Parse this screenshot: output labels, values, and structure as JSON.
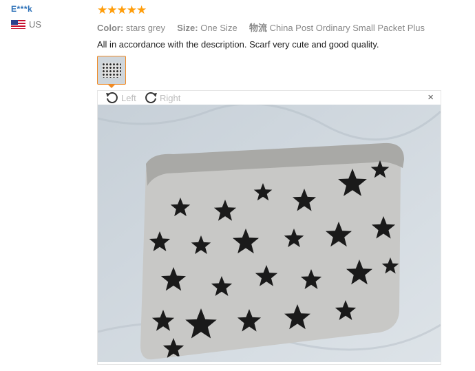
{
  "reviewer": {
    "name": "E***k",
    "country": "US"
  },
  "rating": {
    "stars": "★★★★★",
    "value": 5
  },
  "meta": {
    "color_label": "Color:",
    "color_value": "stars grey",
    "size_label": "Size:",
    "size_value": "One Size",
    "logistics_label": "物流",
    "logistics_value": "China Post Ordinary Small Packet Plus"
  },
  "review_text": "All in accordance with the description. Scarf very cute and good quality.",
  "viewer": {
    "rotate_left": "Left",
    "rotate_right": "Right",
    "close": "×"
  },
  "colors": {
    "accent": "#ff9d0a",
    "link": "#2a6fb7",
    "thumb_border": "#f08a24"
  }
}
